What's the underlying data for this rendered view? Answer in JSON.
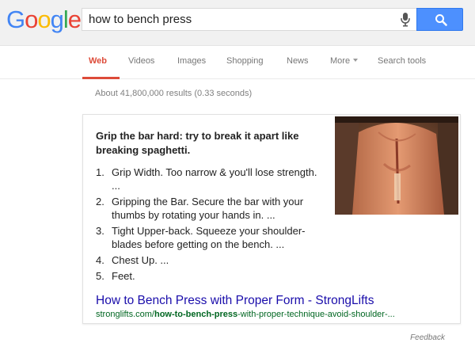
{
  "logo": {
    "letters": [
      {
        "ch": "G",
        "color": "#4285f4"
      },
      {
        "ch": "o",
        "color": "#ea4335"
      },
      {
        "ch": "o",
        "color": "#fbbc05"
      },
      {
        "ch": "g",
        "color": "#4285f4"
      },
      {
        "ch": "l",
        "color": "#34a853"
      },
      {
        "ch": "e",
        "color": "#ea4335"
      }
    ]
  },
  "search": {
    "value": "how to bench press",
    "mic_icon": "microphone-icon",
    "button_icon": "magnifier-icon"
  },
  "nav": {
    "tabs": [
      {
        "label": "Web",
        "active": true
      },
      {
        "label": "Videos"
      },
      {
        "label": "Images"
      },
      {
        "label": "Shopping"
      },
      {
        "label": "News"
      },
      {
        "label": "More"
      },
      {
        "label": "Search tools"
      }
    ]
  },
  "stats": "About 41,800,000 results (0.33 seconds)",
  "card": {
    "heading": "Grip the bar hard: try to break it apart like breaking spaghetti.",
    "steps": [
      {
        "num": "1.",
        "text": "Grip Width. Too narrow & you'll lose strength. ..."
      },
      {
        "num": "2.",
        "text": "Gripping the Bar. Secure the bar with your thumbs by rotating your hands in. ..."
      },
      {
        "num": "3.",
        "text": "Tight Upper-back. Squeeze your shoulder-blades before getting on the bench. ..."
      },
      {
        "num": "4.",
        "text": "Chest Up. ..."
      },
      {
        "num": "5.",
        "text": "Feet."
      }
    ],
    "link_title": "How to Bench Press with Proper Form - StrongLifts",
    "url_prefix": "stronglifts.com/",
    "url_bold": "how-to-bench-press",
    "url_suffix": "-with-proper-technique-avoid-shoulder-..."
  },
  "feedback": "Feedback",
  "colors": {
    "accent": "#dd4b39",
    "link": "#1a0dab",
    "url": "#006621",
    "search_button": "#4d90fe"
  }
}
